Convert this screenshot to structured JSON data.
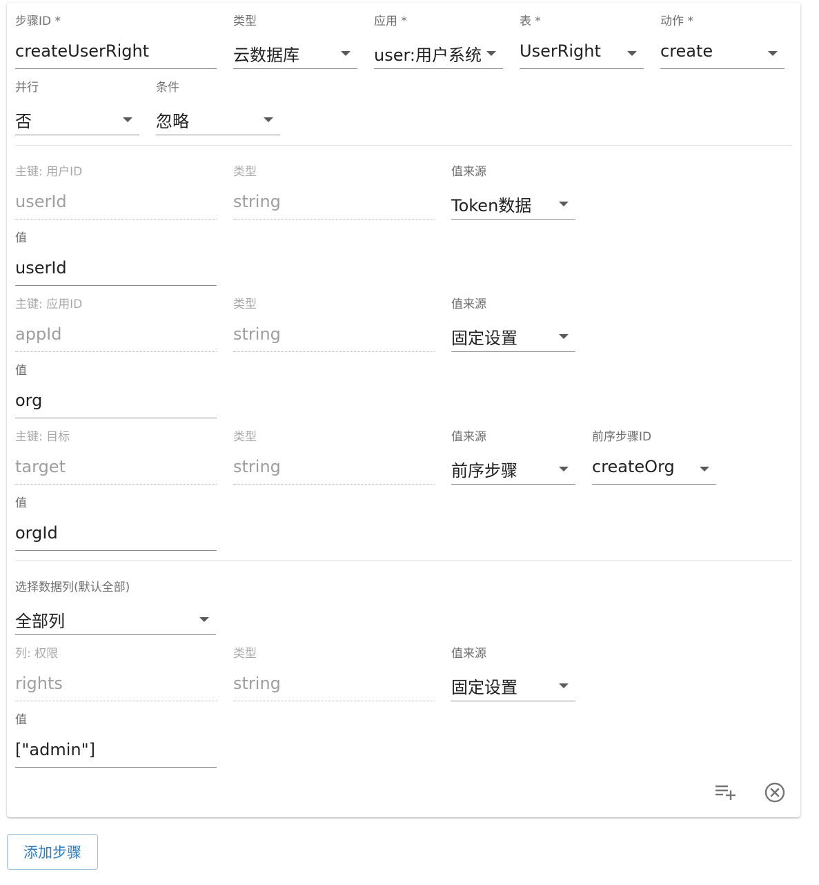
{
  "step": {
    "step_id": {
      "label": "步骤ID *",
      "value": "createUserRight"
    },
    "type": {
      "label": "类型",
      "value": "云数据库"
    },
    "app": {
      "label": "应用 *",
      "value": "user:用户系统"
    },
    "table": {
      "label": "表 *",
      "value": "UserRight"
    },
    "action": {
      "label": "动作 *",
      "value": "create"
    },
    "parallel": {
      "label": "并行",
      "value": "否"
    },
    "condition": {
      "label": "条件",
      "value": "忽略"
    }
  },
  "keys": [
    {
      "key": {
        "label": "主键: 用户ID",
        "value": "userId"
      },
      "type": {
        "label": "类型",
        "value": "string"
      },
      "source": {
        "label": "值来源",
        "value": "Token数据"
      },
      "value": {
        "label": "值",
        "value": "userId"
      }
    },
    {
      "key": {
        "label": "主键: 应用ID",
        "value": "appId"
      },
      "type": {
        "label": "类型",
        "value": "string"
      },
      "source": {
        "label": "值来源",
        "value": "固定设置"
      },
      "value": {
        "label": "值",
        "value": "org"
      }
    },
    {
      "key": {
        "label": "主键: 目标",
        "value": "target"
      },
      "type": {
        "label": "类型",
        "value": "string"
      },
      "source": {
        "label": "值来源",
        "value": "前序步骤"
      },
      "prev_step": {
        "label": "前序步骤ID",
        "value": "createOrg"
      },
      "value": {
        "label": "值",
        "value": "orgId"
      }
    }
  ],
  "columns_select": {
    "label": "选择数据列(默认全部)",
    "value": "全部列"
  },
  "columns": [
    {
      "col": {
        "label": "列: 权限",
        "value": "rights"
      },
      "type": {
        "label": "类型",
        "value": "string"
      },
      "source": {
        "label": "值来源",
        "value": "固定设置"
      },
      "value": {
        "label": "值",
        "value": "[\"admin\"]"
      }
    }
  ],
  "buttons": {
    "add_step": "添加步骤"
  },
  "icons": {
    "add_row": "playlist-add-icon",
    "remove": "close-circle-icon"
  },
  "colors": {
    "accent": "#2f7cbf"
  }
}
